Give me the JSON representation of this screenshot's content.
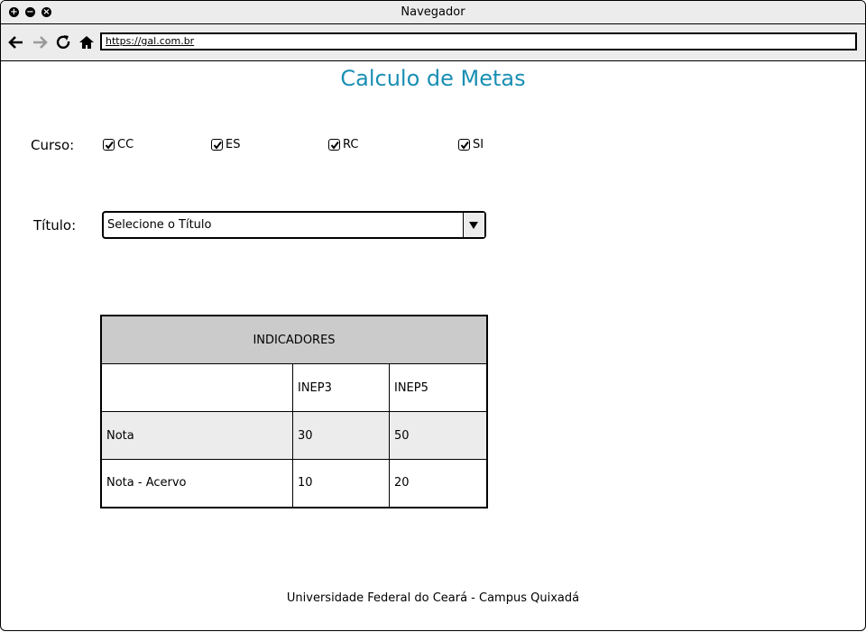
{
  "window": {
    "title": "Navegador"
  },
  "toolbar": {
    "url": "https://gal.com.br"
  },
  "page": {
    "title": "Calculo de Metas"
  },
  "curso": {
    "label": "Curso:",
    "options": [
      {
        "label": "CC",
        "checked": true
      },
      {
        "label": "ES",
        "checked": true
      },
      {
        "label": "RC",
        "checked": true
      },
      {
        "label": "SI",
        "checked": true
      }
    ]
  },
  "titulo": {
    "label": "Título:",
    "selected": "Selecione o Título"
  },
  "table": {
    "header": "INDICADORES",
    "columns": [
      "",
      "INEP3",
      "INEP5"
    ],
    "rows": [
      [
        "Nota",
        "30",
        "50"
      ],
      [
        "Nota - Acervo",
        "10",
        "20"
      ]
    ]
  },
  "footer": {
    "text": "Universidade Federal do Ceará - Campus Quixadá"
  }
}
